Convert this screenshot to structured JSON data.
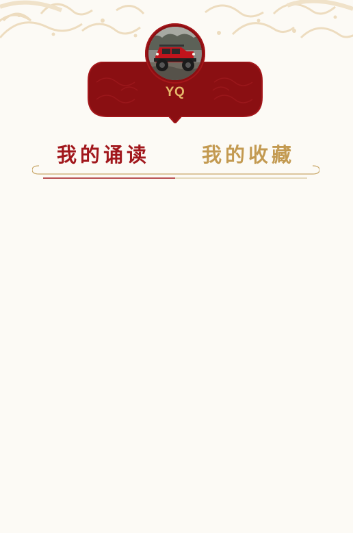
{
  "profile": {
    "username": "YQ",
    "avatar_icon": "avatar-jeep-photo"
  },
  "tabs": [
    {
      "label": "我的诵读",
      "active": true
    },
    {
      "label": "我的收藏",
      "active": false
    }
  ],
  "colors": {
    "background": "#fcfaf5",
    "card_red": "#8a0f12",
    "active_tab": "#a1171c",
    "inactive_tab": "#c39a51",
    "username_gold": "#e5b86a",
    "pattern": "#eddcbf"
  }
}
